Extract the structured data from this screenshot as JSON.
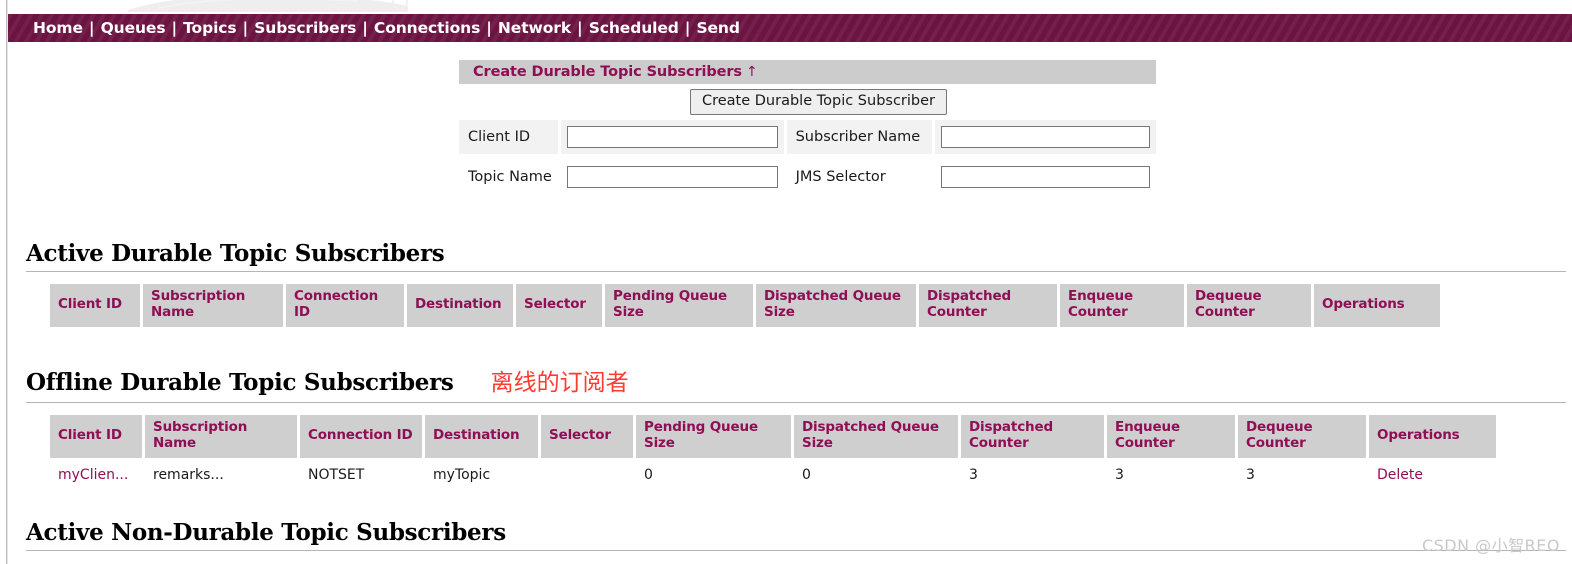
{
  "nav": {
    "separator": "|",
    "items": [
      {
        "label": "Home"
      },
      {
        "label": "Queues"
      },
      {
        "label": "Topics"
      },
      {
        "label": "Subscribers"
      },
      {
        "label": "Connections"
      },
      {
        "label": "Network"
      },
      {
        "label": "Scheduled"
      },
      {
        "label": "Send"
      }
    ]
  },
  "create_form": {
    "title": "Create Durable Topic Subscribers",
    "title_arrow": "↑",
    "submit_label": "Create Durable Topic Subscriber",
    "fields": {
      "client_id": {
        "label": "Client ID",
        "value": "",
        "placeholder": ""
      },
      "subscriber_name": {
        "label": "Subscriber Name",
        "value": "",
        "placeholder": ""
      },
      "topic_name": {
        "label": "Topic Name",
        "value": "",
        "placeholder": ""
      },
      "jms_selector": {
        "label": "JMS Selector",
        "value": "",
        "placeholder": ""
      }
    }
  },
  "columns": [
    "Client ID",
    "Subscription Name",
    "Connection ID",
    "Destination",
    "Selector",
    "Pending Queue Size",
    "Dispatched Queue Size",
    "Dispatched Counter",
    "Enqueue Counter",
    "Dequeue Counter",
    "Operations"
  ],
  "active_durable": {
    "heading": "Active Durable Topic Subscribers",
    "rows": []
  },
  "offline_durable": {
    "heading": "Offline Durable Topic Subscribers",
    "annotation": "离线的订阅者",
    "rows": [
      {
        "client_id": "myClien...",
        "subscription_name": "remarks...",
        "connection_id": "NOTSET",
        "destination": "myTopic",
        "selector": "",
        "pending_queue_size": "0",
        "dispatched_queue_size": "0",
        "dispatched_counter": "3",
        "enqueue_counter": "3",
        "dequeue_counter": "3",
        "operation": "Delete"
      }
    ]
  },
  "active_non_durable": {
    "heading": "Active Non-Durable Topic Subscribers"
  },
  "watermark": "CSDN @小智REO",
  "colors": {
    "nav_bar": "#6b1341",
    "accent_link": "#8f0f55",
    "table_header_bg": "#cfcfcf",
    "panel_title_bg": "#cccccc",
    "annotation_red": "#ff3b30"
  }
}
